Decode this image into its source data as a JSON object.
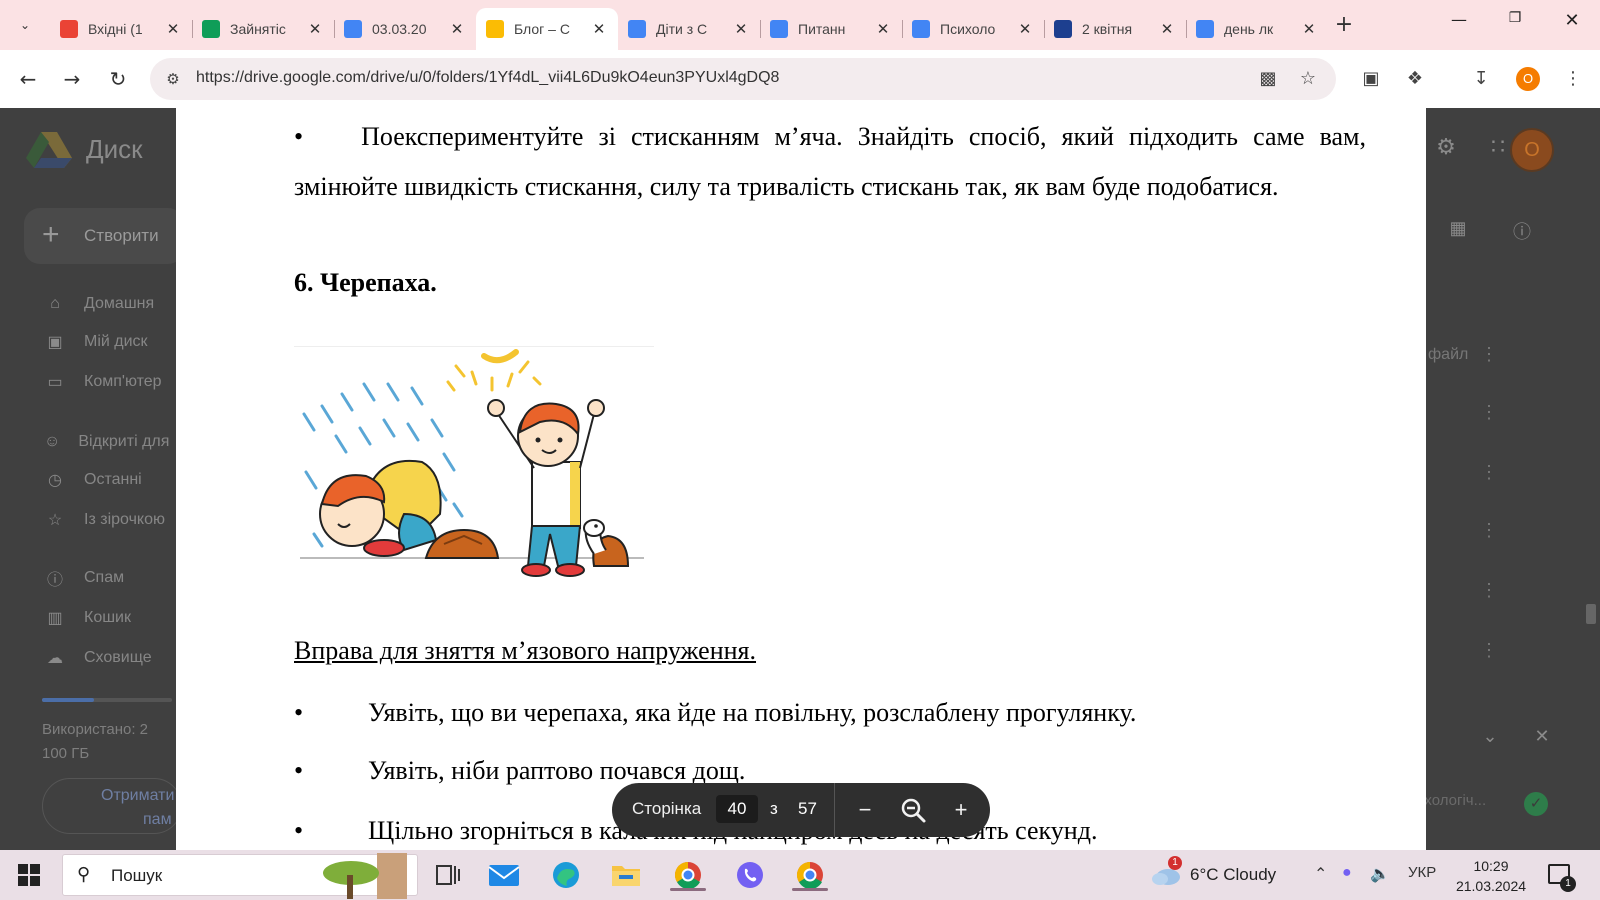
{
  "browser": {
    "tabs": [
      {
        "title": "Вхідні (1",
        "favicon": "gmail-icon",
        "color": "#ea4335"
      },
      {
        "title": "Зайнятіс",
        "favicon": "sheets-icon",
        "color": "#0f9d58"
      },
      {
        "title": "03.03.20",
        "favicon": "docs-icon",
        "color": "#4285f4"
      },
      {
        "title": "Блог – С",
        "favicon": "drive-icon",
        "color": "#fbbc04",
        "active": true
      },
      {
        "title": "Діти з С",
        "favicon": "docs-icon",
        "color": "#4285f4"
      },
      {
        "title": "Питанн",
        "favicon": "docs-icon",
        "color": "#4285f4"
      },
      {
        "title": "Психоло",
        "favicon": "google-icon",
        "color": "#4285f4"
      },
      {
        "title": "2 квітня",
        "favicon": "ukraine-emblem-icon",
        "color": "#1d3f8f"
      },
      {
        "title": "день лк",
        "favicon": "google-icon",
        "color": "#4285f4"
      }
    ],
    "url": "https://drive.google.com/drive/u/0/folders/1Yf4dL_vii4L6Du9kO4eun3PYUxl4gDQ8",
    "profile_initial": "O"
  },
  "drive": {
    "app_name": "Диск",
    "create_label": "Створити",
    "sidebar": [
      {
        "label": "Домашня",
        "icon": "home-icon"
      },
      {
        "label": "Мій диск",
        "icon": "my-drive-icon"
      },
      {
        "label": "Комп'ютер",
        "icon": "computer-icon"
      },
      {
        "label": "Відкриті для мене",
        "icon": "shared-icon"
      },
      {
        "label": "Останні",
        "icon": "clock-icon"
      },
      {
        "label": "Із зірочкою",
        "icon": "star-icon"
      },
      {
        "label": "Спам",
        "icon": "spam-icon"
      },
      {
        "label": "Кошик",
        "icon": "trash-icon"
      },
      {
        "label": "Сховище",
        "icon": "cloud-icon"
      }
    ],
    "storage_line1": "Використано: 2",
    "storage_line2": "100 ГБ",
    "get_storage": "Отримати",
    "get_storage_2": "пам",
    "file_label_1": "файл",
    "file_label_2": "ихологіч...",
    "avatar_initial": "O"
  },
  "document": {
    "para1_bullet": "•",
    "para1_text": "Поекспериментуйте зі стисканням м’яча. Знайдіть спосіб, який підходить саме вам, змінюйте швидкість стискання, силу та тривалість стискань так, як вам буде подобатися.",
    "heading": "6. Черепаха.",
    "subhead": "Вправа для зняття м’язового напруження.",
    "bullets": [
      "Уявіть, що ви черепаха, яка йде на повільну, розслаблену прогулянку.",
      "Уявіть, ніби раптово почався дощ.",
      "Щільно згорніться в калачик під панциром десь на десять секунд."
    ]
  },
  "pdf_toolbar": {
    "page_label": "Сторінка",
    "current_page": "40",
    "of_label": "з",
    "total_pages": "57"
  },
  "taskbar": {
    "search_placeholder": "Пошук",
    "weather_badge": "1",
    "weather": "6°C  Cloudy",
    "language": "УКР",
    "time": "10:29",
    "date": "21.03.2024",
    "notification_count": "1"
  }
}
